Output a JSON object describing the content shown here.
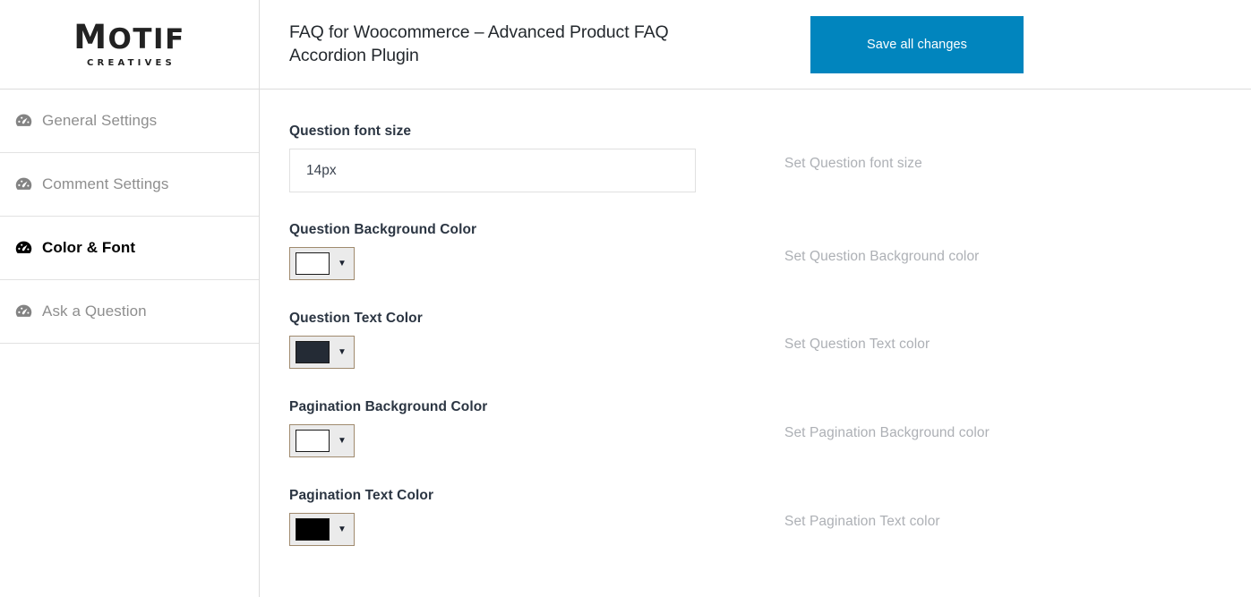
{
  "sidebar": {
    "logo": {
      "main_first": "M",
      "main_rest": "OTIF",
      "sub": "CREATIVES"
    },
    "items": [
      {
        "label": "General Settings",
        "icon": "gauge-icon",
        "active": false
      },
      {
        "label": "Comment Settings",
        "icon": "gauge-icon",
        "active": false
      },
      {
        "label": "Color & Font",
        "icon": "gauge-icon",
        "active": true
      },
      {
        "label": "Ask a Question",
        "icon": "gauge-icon",
        "active": false
      }
    ]
  },
  "header": {
    "title": "FAQ for Woocommerce – Advanced Product FAQ Accordion Plugin",
    "save_label": "Save all changes",
    "save_color": "#0185be"
  },
  "fields": {
    "question_font_size": {
      "label": "Question font size",
      "value": "14px",
      "placeholder": "14px",
      "description": "Set Question font size"
    },
    "question_bg_color": {
      "label": "Question Background Color",
      "value": "#ffffff",
      "description": "Set Question Background color"
    },
    "question_text_color": {
      "label": "Question Text Color",
      "value": "#242b35",
      "description": "Set Question Text color"
    },
    "pagination_bg_color": {
      "label": "Pagination Background Color",
      "value": "#ffffff",
      "description": "Set Pagination Background color"
    },
    "pagination_text_color": {
      "label": "Pagination Text Color",
      "value": "#000000",
      "description": "Set Pagination Text color"
    }
  },
  "icons": {
    "dropdown_arrow": "▼"
  }
}
